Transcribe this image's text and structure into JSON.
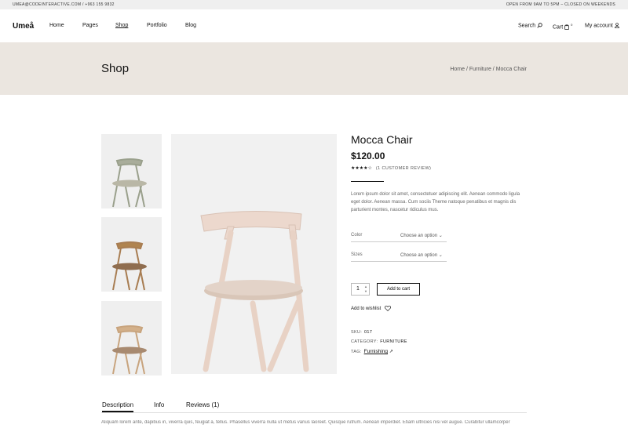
{
  "topbar": {
    "contact": "UMEA@CODEINTERACTIVE.COM / +963 155 9832",
    "hours": "OPEN FROM 9AM TO 5PM – CLOSED ON WEEKENDS"
  },
  "header": {
    "logo": "Umeå",
    "nav": [
      "Home",
      "Pages",
      "Shop",
      "Portfolio",
      "Blog"
    ],
    "search_label": "Search",
    "cart_label": "Cart",
    "cart_count": "0",
    "account_label": "My account"
  },
  "page": {
    "title": "Shop",
    "breadcrumb": [
      "Home",
      "Furniture",
      "Mocca Chair"
    ]
  },
  "product": {
    "name": "Mocca Chair",
    "price": "$120.00",
    "stars": "★★★★☆",
    "rating": 4,
    "reviews_text": "(1 CUSTOMER REVIEW)",
    "description": "Lorem ipsum dolor sit amet, consectetuer adipiscing elit. Aenean commodo ligula eget dolor. Aenean massa. Cum sociis Theme natoque penatibus et magnis dis parturient montes, nascetur ridiculus mus.",
    "color_label": "Color",
    "color_value": "Choose an option",
    "sizes_label": "Sizes",
    "sizes_value": "Choose an option",
    "quantity": "1",
    "add_to_cart": "Add to cart",
    "wishlist": "Add to wishlist",
    "sku_label": "SKU:",
    "sku": "017",
    "category_label": "CATEGORY:",
    "category": "FURNITURE",
    "tag_label": "TAG:",
    "tag": "Furnishing"
  },
  "colors": {
    "banner": "#ebe6e0",
    "thumb_chairs": [
      "#9aa08c",
      "#a87d52",
      "#c8a47e"
    ],
    "main_chair": "#ecd8cd"
  },
  "tabs": {
    "items": [
      "Description",
      "Info",
      "Reviews (1)"
    ],
    "active": "Description",
    "content": "Aliquam lorem ante, dapibus in, viverra quis, feugiat a, tellus. Phasellus viverra nulla ut metus varius laoreet. Quisque rutrum. Aenean imperdiet. Etiam ultricies nisi vel augue. Curabitur ullamcorper"
  }
}
